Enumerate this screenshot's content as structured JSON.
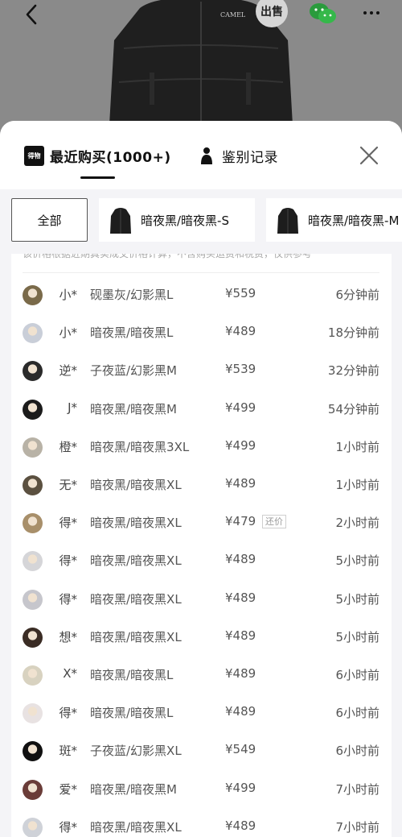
{
  "header": {
    "sell_label": "出售",
    "brand_text": "CAMEL"
  },
  "sheet": {
    "tabs": [
      {
        "logo_text": "得物",
        "label": "最近购买(1000+)"
      },
      {
        "label": "鉴别记录"
      }
    ],
    "filters": [
      "全部",
      "暗夜黑/暗夜黑-S",
      "暗夜黑/暗夜黑-M"
    ],
    "notice": "该价格根据近期真实成交价格计算，不含购买运费和税费，仅供参考",
    "purchases": [
      {
        "buyer": "小*",
        "variant": "砚墨灰/幻影黑L",
        "price": "¥559",
        "time": "6分钟前"
      },
      {
        "buyer": "小*",
        "variant": "暗夜黑/暗夜黑L",
        "price": "¥489",
        "time": "18分钟前"
      },
      {
        "buyer": "逆*",
        "variant": "子夜蓝/幻影黑M",
        "price": "¥539",
        "time": "32分钟前"
      },
      {
        "buyer": "J*",
        "variant": "暗夜黑/暗夜黑M",
        "price": "¥499",
        "time": "54分钟前"
      },
      {
        "buyer": "橙*",
        "variant": "暗夜黑/暗夜黑3XL",
        "price": "¥499",
        "time": "1小时前"
      },
      {
        "buyer": "无*",
        "variant": "暗夜黑/暗夜黑XL",
        "price": "¥489",
        "time": "1小时前"
      },
      {
        "buyer": "得*",
        "variant": "暗夜黑/暗夜黑XL",
        "price": "¥479",
        "tag": "还价",
        "time": "2小时前"
      },
      {
        "buyer": "得*",
        "variant": "暗夜黑/暗夜黑XL",
        "price": "¥489",
        "time": "5小时前"
      },
      {
        "buyer": "得*",
        "variant": "暗夜黑/暗夜黑XL",
        "price": "¥489",
        "time": "5小时前"
      },
      {
        "buyer": "想*",
        "variant": "暗夜黑/暗夜黑XL",
        "price": "¥489",
        "time": "5小时前"
      },
      {
        "buyer": "X*",
        "variant": "暗夜黑/暗夜黑L",
        "price": "¥489",
        "time": "6小时前"
      },
      {
        "buyer": "得*",
        "variant": "暗夜黑/暗夜黑L",
        "price": "¥489",
        "time": "6小时前"
      },
      {
        "buyer": "斑*",
        "variant": "子夜蓝/幻影黑XL",
        "price": "¥549",
        "time": "6小时前"
      },
      {
        "buyer": "爱*",
        "variant": "暗夜黑/暗夜黑M",
        "price": "¥499",
        "time": "7小时前"
      },
      {
        "buyer": "得*",
        "variant": "暗夜黑/暗夜黑XL",
        "price": "¥489",
        "time": "7小时前"
      }
    ]
  },
  "colors": {
    "avatar_palette": [
      "#7a6a4a",
      "#c9ced8",
      "#2a2a2a",
      "#1b1b1b",
      "#b8b2a6",
      "#5b5040",
      "#a88f6a",
      "#d5d5d8",
      "#c6c6cc",
      "#3a2c24",
      "#d8d2c0",
      "#e8e2e2",
      "#101010",
      "#6a3c38",
      "#cfd2d8"
    ]
  }
}
